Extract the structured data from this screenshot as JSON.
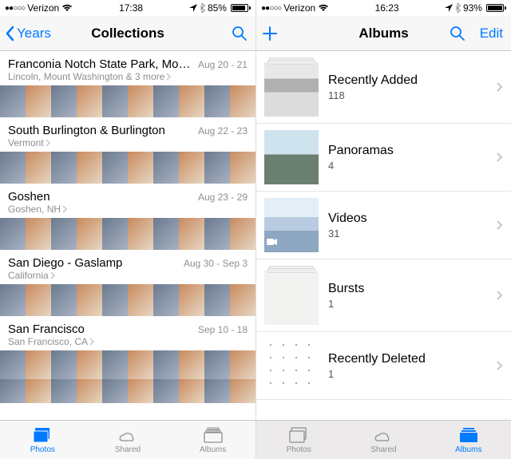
{
  "left": {
    "status": {
      "carrier": "Verizon",
      "signal_dots": "●●○○○",
      "time": "17:38",
      "battery_pct": "85%"
    },
    "nav": {
      "back": "Years",
      "title": "Collections"
    },
    "collections": [
      {
        "title": "Franconia Notch State Park, Mount Washing...",
        "subtitle": "Lincoln, Mount Washington & 3 more",
        "date": "Aug 20 - 21"
      },
      {
        "title": "South Burlington & Burlington",
        "subtitle": "Vermont",
        "date": "Aug 22 - 23"
      },
      {
        "title": "Goshen",
        "subtitle": "Goshen, NH",
        "date": "Aug 23 - 29"
      },
      {
        "title": "San Diego - Gaslamp",
        "subtitle": "California",
        "date": "Aug 30 - Sep 3"
      },
      {
        "title": "San Francisco",
        "subtitle": "San Francisco, CA",
        "date": "Sep 10 - 18"
      }
    ],
    "tabs": {
      "photos": "Photos",
      "shared": "Shared",
      "albums": "Albums",
      "active": "photos"
    }
  },
  "right": {
    "status": {
      "carrier": "Verizon",
      "signal_dots": "●●○○○",
      "time": "16:23",
      "battery_pct": "93%"
    },
    "nav": {
      "title": "Albums",
      "edit": "Edit"
    },
    "albums": [
      {
        "name": "Recently Added",
        "count": "118"
      },
      {
        "name": "Panoramas",
        "count": "4"
      },
      {
        "name": "Videos",
        "count": "31"
      },
      {
        "name": "Bursts",
        "count": "1"
      },
      {
        "name": "Recently Deleted",
        "count": "1"
      }
    ],
    "tabs": {
      "photos": "Photos",
      "shared": "Shared",
      "albums": "Albums",
      "active": "albums"
    }
  }
}
